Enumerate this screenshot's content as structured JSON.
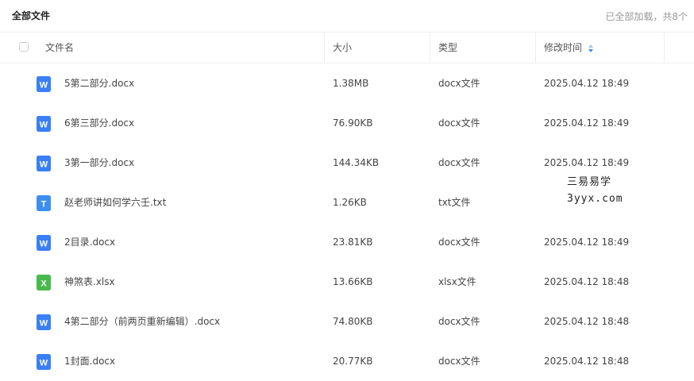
{
  "header": {
    "title": "全部文件",
    "status": "已全部加载，共8个"
  },
  "columns": {
    "name": "文件名",
    "size": "大小",
    "type": "类型",
    "time": "修改时间"
  },
  "files": [
    {
      "name": "5第二部分.docx",
      "size": "1.38MB",
      "type": "docx文件",
      "time": "2025.04.12 18:49",
      "icon": "word-doc-icon"
    },
    {
      "name": "6第三部分.docx",
      "size": "76.90KB",
      "type": "docx文件",
      "time": "2025.04.12 18:49",
      "icon": "word-doc-icon"
    },
    {
      "name": "3第一部分.docx",
      "size": "144.34KB",
      "type": "docx文件",
      "time": "2025.04.12 18:49",
      "icon": "word-doc-icon"
    },
    {
      "name": "赵老师讲如何学六壬.txt",
      "size": "1.26KB",
      "type": "txt文件",
      "time": "",
      "icon": "text-file-icon"
    },
    {
      "name": "2目录.docx",
      "size": "23.81KB",
      "type": "docx文件",
      "time": "2025.04.12 18:49",
      "icon": "word-doc-icon"
    },
    {
      "name": "神煞表.xlsx",
      "size": "13.66KB",
      "type": "xlsx文件",
      "time": "2025.04.12 18:48",
      "icon": "excel-sheet-icon"
    },
    {
      "name": "4第二部分（前两页重新编辑）.docx",
      "size": "74.80KB",
      "type": "docx文件",
      "time": "2025.04.12 18:48",
      "icon": "word-doc-icon"
    },
    {
      "name": "1封面.docx",
      "size": "20.77KB",
      "type": "docx文件",
      "time": "2025.04.12 18:48",
      "icon": "word-doc-icon"
    }
  ],
  "watermark": {
    "line1": "三易易学",
    "line2": "3yyx.com"
  },
  "colors": {
    "word": "#3a7ff6",
    "txt": "#3d8ef0",
    "excel": "#48b94c",
    "sort": "#3a8ee6"
  }
}
